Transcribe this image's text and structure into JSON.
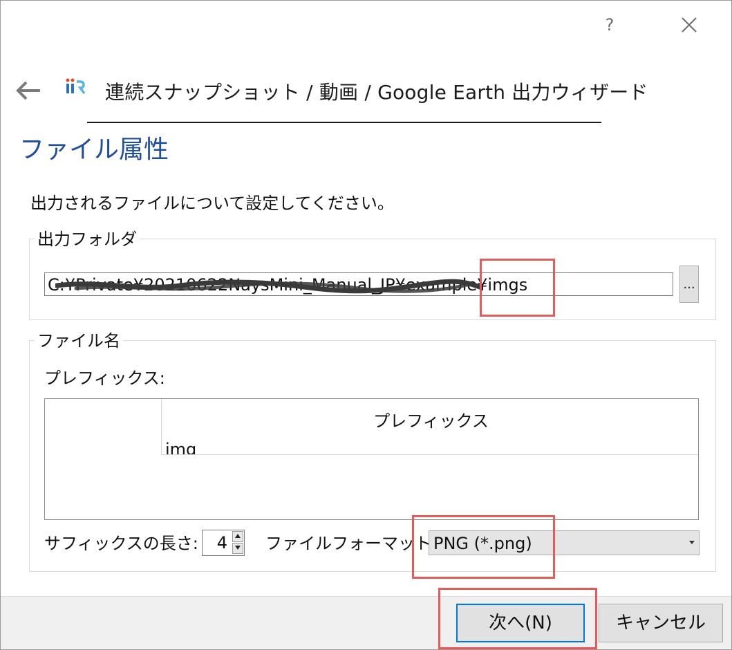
{
  "titlebar": {
    "help_label": "?"
  },
  "wizard": {
    "title": "連続スナップショット / 動画 / Google Earth 出力ウィザード"
  },
  "page": {
    "title": "ファイル属性",
    "instruction": "出力されるファイルについて設定してください。"
  },
  "output_folder": {
    "group_label": "出力フォルダ",
    "path": "C:¥Private¥20210622NaysMini_Manual_JP¥example¥imgs",
    "browse_label": "..."
  },
  "file_name": {
    "group_label": "ファイル名",
    "prefix_label": "プレフィックス:",
    "table": {
      "column_header": "プレフィックス",
      "cell": "img"
    },
    "suffix_label": "サフィックスの長さ:",
    "suffix_length": "4",
    "format_label": "ファイルフォーマット:",
    "format_value": "PNG (*.png)"
  },
  "buttons": {
    "next": "次へ(N)",
    "cancel": "キャンセル"
  },
  "colors": {
    "title_blue": "#1f4ea1",
    "highlight_red": "#e35b5b",
    "focus_blue": "#0078d7"
  },
  "icons": [
    "close-icon",
    "back-arrow-icon",
    "app-logo",
    "spin-up-icon",
    "spin-down-icon",
    "dropdown-arrow-icon"
  ]
}
